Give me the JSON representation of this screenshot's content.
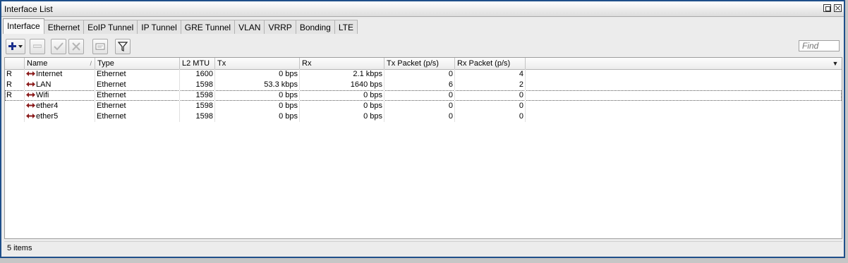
{
  "window": {
    "title": "Interface List"
  },
  "tabs": [
    "Interface",
    "Ethernet",
    "EoIP Tunnel",
    "IP Tunnel",
    "GRE Tunnel",
    "VLAN",
    "VRRP",
    "Bonding",
    "LTE"
  ],
  "active_tab": "Interface",
  "search": {
    "placeholder": "Find"
  },
  "table": {
    "headers": [
      "",
      "Name",
      "Type",
      "L2 MTU",
      "Tx",
      "Rx",
      "Tx Packet (p/s)",
      "Rx Packet (p/s)"
    ],
    "sorted_column": "Name",
    "rows": [
      {
        "flag": "R",
        "name": "Internet",
        "type": "Ethernet",
        "l2mtu": "1600",
        "tx": "0 bps",
        "rx": "2.1 kbps",
        "tx_pps": "0",
        "rx_pps": "4"
      },
      {
        "flag": "R",
        "name": "LAN",
        "type": "Ethernet",
        "l2mtu": "1598",
        "tx": "53.3 kbps",
        "rx": "1640 bps",
        "tx_pps": "6",
        "rx_pps": "2"
      },
      {
        "flag": "R",
        "name": "Wifi",
        "type": "Ethernet",
        "l2mtu": "1598",
        "tx": "0 bps",
        "rx": "0 bps",
        "tx_pps": "0",
        "rx_pps": "0"
      },
      {
        "flag": "",
        "name": "ether4",
        "type": "Ethernet",
        "l2mtu": "1598",
        "tx": "0 bps",
        "rx": "0 bps",
        "tx_pps": "0",
        "rx_pps": "0"
      },
      {
        "flag": "",
        "name": "ether5",
        "type": "Ethernet",
        "l2mtu": "1598",
        "tx": "0 bps",
        "rx": "0 bps",
        "tx_pps": "0",
        "rx_pps": "0"
      }
    ]
  },
  "status": {
    "count_text": "5 items"
  },
  "toolbar": {
    "buttons": [
      "add-icon",
      "remove-icon",
      "enable-icon",
      "disable-icon",
      "comment-icon",
      "filter-icon"
    ]
  },
  "colors": {
    "add_icon": "#1a2f8c",
    "iface_icon": "#8b1a1a",
    "window_border": "#1f4f8a"
  }
}
